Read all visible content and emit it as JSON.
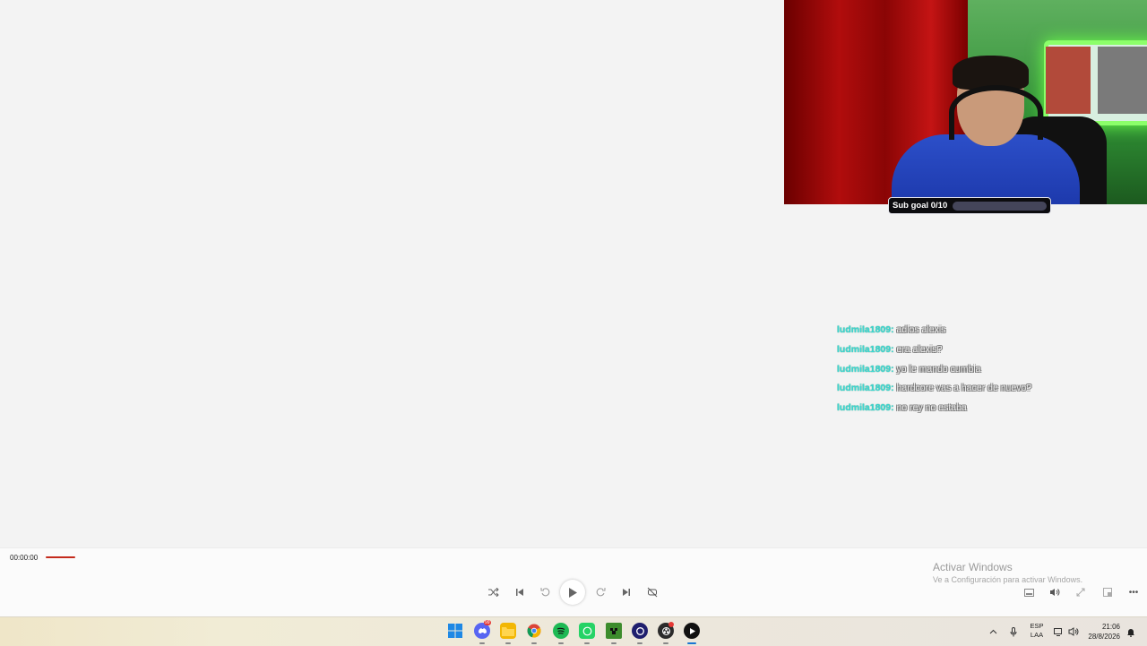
{
  "webcam": {
    "subgoal_label": "Sub goal 0/10",
    "subgoal_progress": 0.0
  },
  "chat": [
    {
      "user": "ludmila1809:",
      "text": "adios alexis"
    },
    {
      "user": "ludmila1809:",
      "text": "era alexis?"
    },
    {
      "user": "ludmila1809:",
      "text": "yo le mando cumbia"
    },
    {
      "user": "ludmila1809:",
      "text": "hardcore vas a hacer de nuevo?"
    },
    {
      "user": "ludmila1809:",
      "text": "no rey no estaba"
    }
  ],
  "player": {
    "time": "00:00:00",
    "controls": [
      "shuffle-icon",
      "previous-icon",
      "rewind-10-icon",
      "play-icon",
      "forward-30-icon",
      "next-icon",
      "repeat-off-icon"
    ],
    "right_controls": [
      "miniplayer-icon",
      "volume-icon",
      "fullscreen-icon",
      "cast-icon",
      "more-icon"
    ],
    "accent_color": "#c42b1c"
  },
  "watermark": {
    "title": "Activar Windows",
    "subtitle": "Ve a Configuración para activar Windows."
  },
  "taskbar": {
    "apps": [
      {
        "name": "start-icon",
        "color": "#1e88e5"
      },
      {
        "name": "discord-icon",
        "color": "#5865f2",
        "badge": "99"
      },
      {
        "name": "file-explorer-icon",
        "color": "#f2b705"
      },
      {
        "name": "chrome-icon",
        "color": "#db4437"
      },
      {
        "name": "spotify-icon",
        "color": "#1db954"
      },
      {
        "name": "whatsapp-icon",
        "color": "#25d366"
      },
      {
        "name": "minecraft-icon",
        "color": "#3c8c2c"
      },
      {
        "name": "app-circle-icon",
        "color": "#1f1f6e"
      },
      {
        "name": "obs-icon",
        "color": "#2b2b2b"
      },
      {
        "name": "media-player-icon",
        "color": "#111111"
      }
    ],
    "lang_top": "ESP",
    "lang_bottom": "LAA",
    "time": "21:06",
    "date": "28/8/2026"
  }
}
